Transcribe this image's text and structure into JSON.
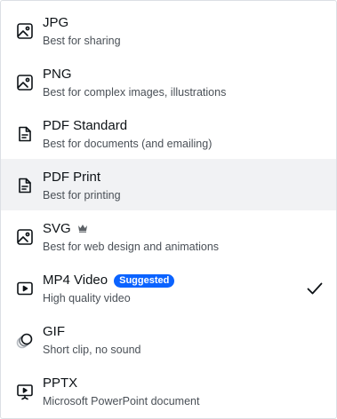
{
  "formats": [
    {
      "key": "jpg",
      "title": "JPG",
      "desc": "Best for sharing",
      "icon": "image-icon"
    },
    {
      "key": "png",
      "title": "PNG",
      "desc": "Best for complex images, illustrations",
      "icon": "image-icon"
    },
    {
      "key": "pdf-standard",
      "title": "PDF Standard",
      "desc": "Best for documents (and emailing)",
      "icon": "document-icon"
    },
    {
      "key": "pdf-print",
      "title": "PDF Print",
      "desc": "Best for printing",
      "icon": "document-icon",
      "hovered": true
    },
    {
      "key": "svg",
      "title": "SVG",
      "desc": "Best for web design and animations",
      "icon": "image-icon",
      "premium": true
    },
    {
      "key": "mp4",
      "title": "MP4 Video",
      "desc": "High quality video",
      "icon": "video-icon",
      "badge": "Suggested",
      "selected": true
    },
    {
      "key": "gif",
      "title": "GIF",
      "desc": "Short clip, no sound",
      "icon": "gif-icon"
    },
    {
      "key": "pptx",
      "title": "PPTX",
      "desc": "Microsoft PowerPoint document",
      "icon": "presentation-icon"
    }
  ],
  "colors": {
    "badge": "#0b63ff",
    "hover": "#f1f2f4",
    "text": "#0d1216",
    "muted": "#4a5057"
  }
}
